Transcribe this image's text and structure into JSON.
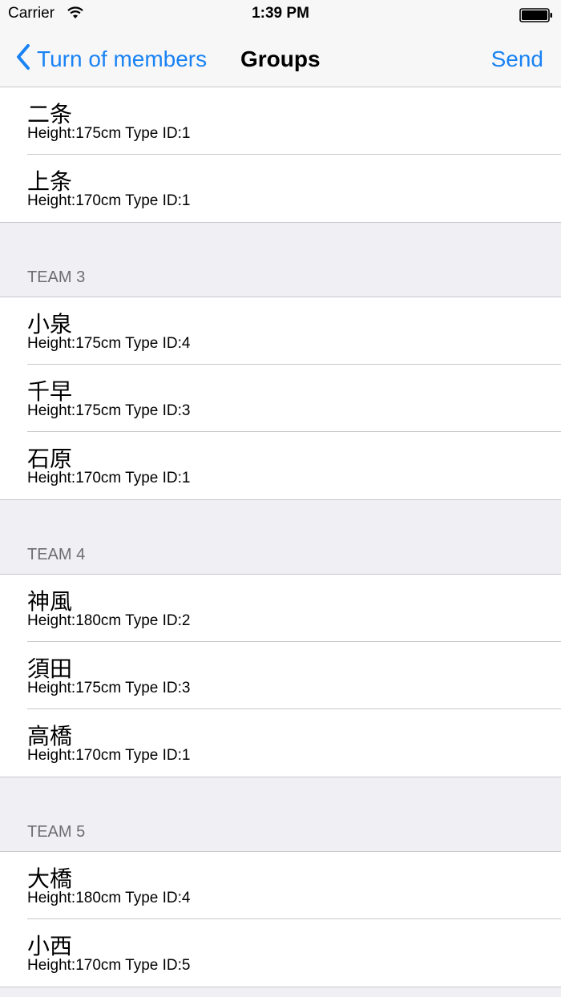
{
  "status_bar": {
    "carrier": "Carrier",
    "time": "1:39 PM"
  },
  "nav": {
    "back_label": "Turn of members",
    "title": "Groups",
    "send_label": "Send",
    "accent_color": "#1a83f4"
  },
  "groups": [
    {
      "header": "",
      "items": [
        {
          "name": "二条",
          "detail": "Height:175cm Type ID:1"
        },
        {
          "name": "上条",
          "detail": "Height:170cm Type ID:1"
        }
      ]
    },
    {
      "header": "TEAM 3",
      "items": [
        {
          "name": "小泉",
          "detail": "Height:175cm Type ID:4"
        },
        {
          "name": "千早",
          "detail": "Height:175cm Type ID:3"
        },
        {
          "name": "石原",
          "detail": "Height:170cm Type ID:1"
        }
      ]
    },
    {
      "header": "TEAM 4",
      "items": [
        {
          "name": "神風",
          "detail": "Height:180cm Type ID:2"
        },
        {
          "name": "須田",
          "detail": "Height:175cm Type ID:3"
        },
        {
          "name": "高橋",
          "detail": "Height:170cm Type ID:1"
        }
      ]
    },
    {
      "header": "TEAM 5",
      "items": [
        {
          "name": "大橋",
          "detail": "Height:180cm Type ID:4"
        },
        {
          "name": "小西",
          "detail": "Height:170cm Type ID:5"
        }
      ]
    }
  ]
}
